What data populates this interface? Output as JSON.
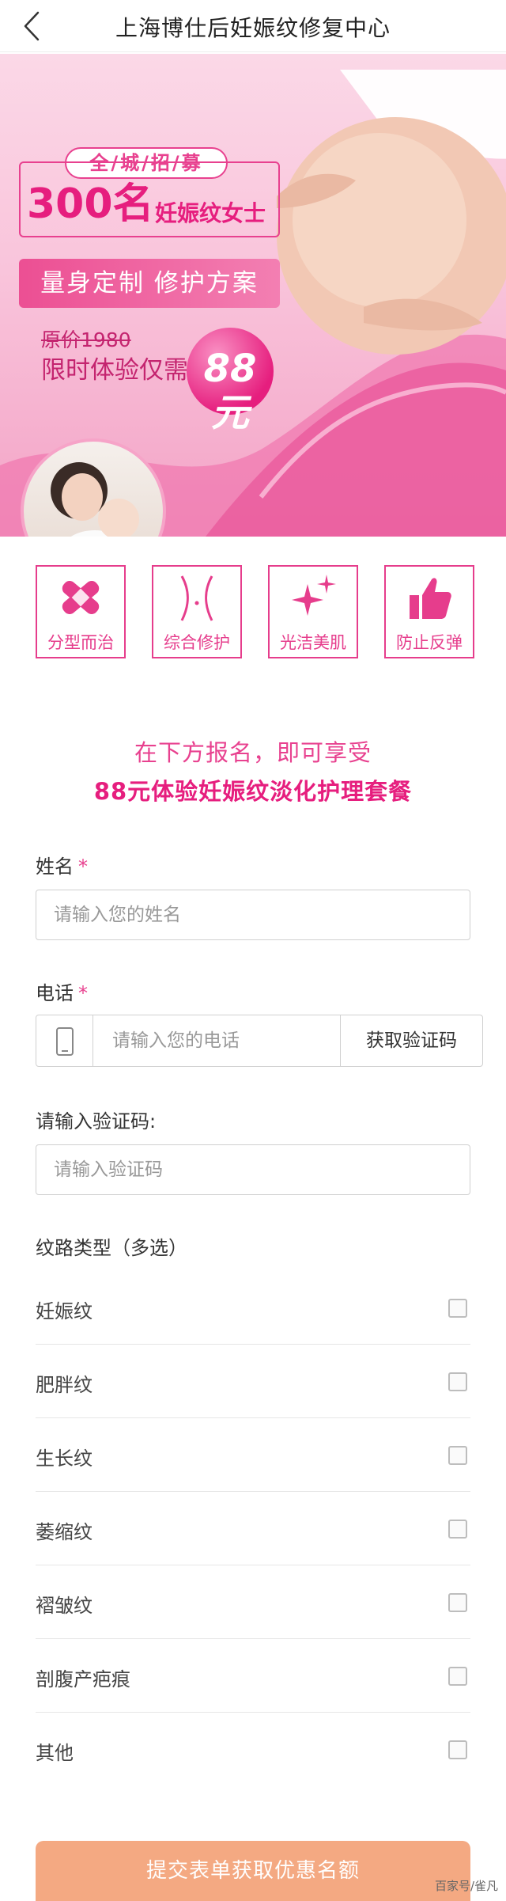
{
  "header": {
    "title": "上海博仕后妊娠纹修复中心"
  },
  "banner": {
    "recruit_tag": "全/城/招/募",
    "count_number": "300名",
    "count_text": "妊娠纹女士",
    "plan_text": "量身定制 修护方案",
    "original_price": "原价1980",
    "limited_text": "限时体验仅需",
    "price": "88元"
  },
  "features": [
    {
      "label": "分型而治",
      "icon": "bandage-icon"
    },
    {
      "label": "综合修护",
      "icon": "waist-icon"
    },
    {
      "label": "光洁美肌",
      "icon": "sparkle-icon"
    },
    {
      "label": "防止反弹",
      "icon": "thumbs-up-icon"
    }
  ],
  "intro": {
    "line1": "在下方报名，即可享受",
    "line2": "88元体验妊娠纹淡化护理套餐"
  },
  "form": {
    "name_label": "姓名",
    "name_required": "*",
    "name_placeholder": "请输入您的姓名",
    "phone_label": "电话",
    "phone_required": "*",
    "phone_placeholder": "请输入您的电话",
    "code_button": "获取验证码",
    "code_label": "请输入验证码:",
    "code_placeholder": "请输入验证码",
    "type_label": "纹路类型（多选）",
    "options": [
      "妊娠纹",
      "肥胖纹",
      "生长纹",
      "萎缩纹",
      "褶皱纹",
      "剖腹产疤痕",
      "其他"
    ],
    "submit": "提交表单获取优惠名额"
  },
  "watermark": "百家号/雀凡",
  "colors": {
    "accent_pink": "#e8418f",
    "deep_pink": "#e61e7e",
    "submit_orange": "#f4a982",
    "required_star": "#e8418f"
  }
}
